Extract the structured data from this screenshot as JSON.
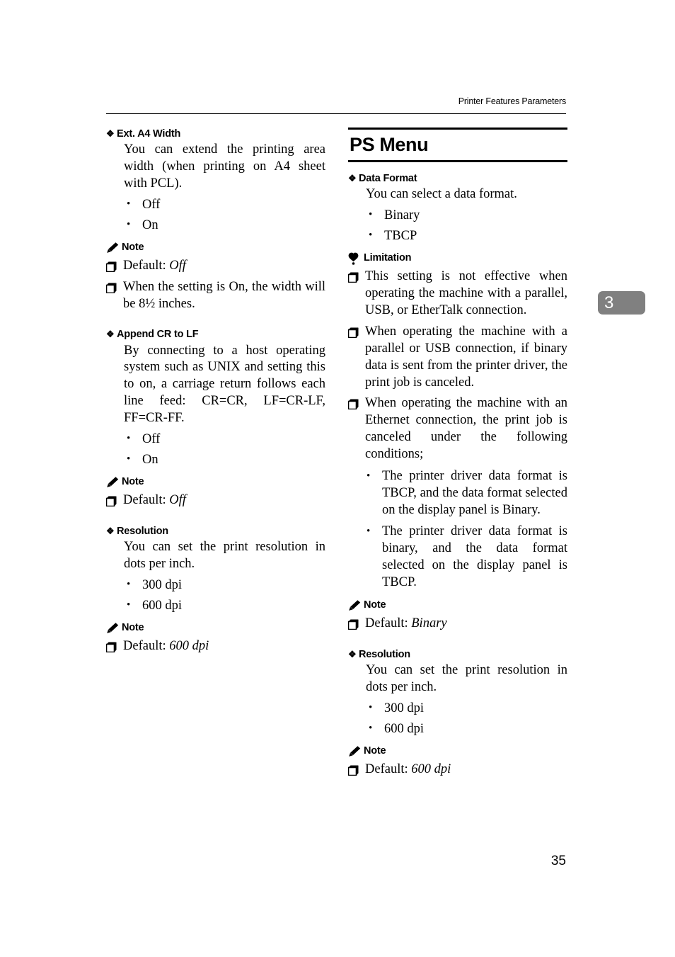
{
  "header": {
    "running_head": "Printer Features Parameters"
  },
  "chapter_tab": {
    "number": "3"
  },
  "folio": {
    "page_number": "35"
  },
  "icons": {
    "diamond": "diamond-bullet-icon",
    "round": "•",
    "square": "square-bullet-icon",
    "note": "pencil-icon",
    "limitation": "balloon-icon"
  },
  "labels": {
    "note": "Note",
    "limitation": "Limitation"
  },
  "left_column": {
    "sections": [
      {
        "title": "Ext. A4 Width",
        "body": "You can extend the printing area width (when printing on A4 sheet with PCL).",
        "options": [
          "Off",
          "On"
        ],
        "note_items": [
          {
            "pre": "Default: ",
            "em": "Off",
            "post": ""
          },
          {
            "pre": "When the setting is On, the width will be 8½ inches.",
            "em": "",
            "post": ""
          }
        ]
      },
      {
        "title": "Append CR to LF",
        "body": "By connecting to a host operating system such as UNIX and setting this to on, a carriage return follows each line feed: CR=CR, LF=CR-LF, FF=CR-FF.",
        "options": [
          "Off",
          "On"
        ],
        "note_items": [
          {
            "pre": "Default: ",
            "em": "Off",
            "post": ""
          }
        ]
      },
      {
        "title": "Resolution",
        "body": "You can set the print resolution in dots per inch.",
        "options": [
          "300 dpi",
          "600 dpi"
        ],
        "note_items": [
          {
            "pre": "Default: ",
            "em": "600 dpi",
            "post": ""
          }
        ]
      }
    ]
  },
  "right_column": {
    "menu_title": "PS Menu",
    "data_format": {
      "title": "Data Format",
      "body": "You can select a data format.",
      "options": [
        "Binary",
        "TBCP"
      ],
      "limitation_items": [
        "This setting is not effective when operating the machine with a parallel, USB, or EtherTalk connection.",
        "When operating the machine with a parallel or USB connection, if binary data is sent from the printer driver, the print job is canceled.",
        "When operating the machine with an Ethernet connection, the print job is canceled under the following conditions;"
      ],
      "limitation_sub_items": [
        "The printer driver data format is TBCP, and the data format selected on the display panel is Binary.",
        "The printer driver data format is binary, and the data format selected on the display panel is TBCP."
      ],
      "note_items": [
        {
          "pre": "Default: ",
          "em": "Binary",
          "post": ""
        }
      ]
    },
    "resolution": {
      "title": "Resolution",
      "body": "You can set the print resolution in dots per inch.",
      "options": [
        "300 dpi",
        "600 dpi"
      ],
      "note_items": [
        {
          "pre": "Default: ",
          "em": "600 dpi",
          "post": ""
        }
      ]
    }
  }
}
